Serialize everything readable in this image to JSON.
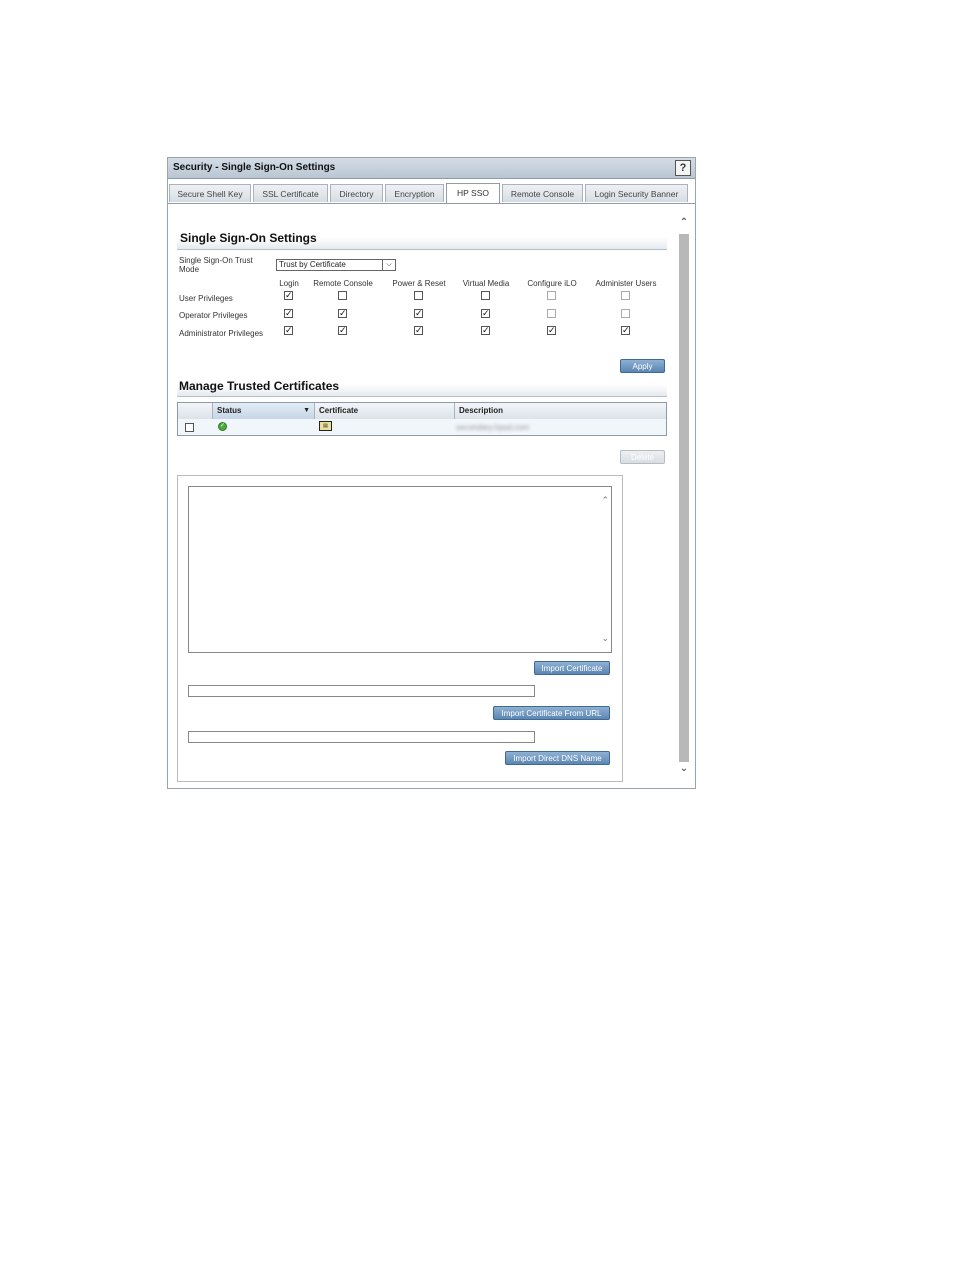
{
  "window": {
    "title": "Security - Single Sign-On Settings",
    "help_label": "?"
  },
  "tabs": [
    {
      "label": "Secure Shell Key"
    },
    {
      "label": "SSL Certificate"
    },
    {
      "label": "Directory"
    },
    {
      "label": "Encryption"
    },
    {
      "label": "HP SSO"
    },
    {
      "label": "Remote Console"
    },
    {
      "label": "Login Security Banner"
    }
  ],
  "active_tab": "HP SSO",
  "sso": {
    "title": "Single Sign-On Settings",
    "trust_mode_label_1": "Single Sign-On Trust",
    "trust_mode_label_2": "Mode",
    "trust_mode_value": "Trust by Certificate",
    "columns": [
      "Login",
      "Remote Console",
      "Power & Reset",
      "Virtual Media",
      "Configure iLO",
      "Administer Users"
    ],
    "rows": [
      {
        "label": "User Privileges",
        "checks": [
          true,
          false,
          false,
          false,
          false,
          false
        ]
      },
      {
        "label": "Operator Privileges",
        "checks": [
          true,
          true,
          true,
          true,
          false,
          false
        ]
      },
      {
        "label": "Administrator Privileges",
        "checks": [
          true,
          true,
          true,
          true,
          true,
          true
        ]
      }
    ],
    "apply_label": "Apply"
  },
  "certs": {
    "title": "Manage Trusted Certificates",
    "headers": {
      "status": "Status",
      "certificate": "Certificate",
      "description": "Description"
    },
    "row": {
      "description": "secondary.hpsd.com"
    },
    "delete_label": "Delete",
    "import_certificate_label": "Import Certificate",
    "import_url_label": "Import Certificate From URL",
    "import_dns_label": "Import Direct DNS Name"
  },
  "colors": {
    "accent": "#5b86b2",
    "ok": "#4caa3c"
  }
}
